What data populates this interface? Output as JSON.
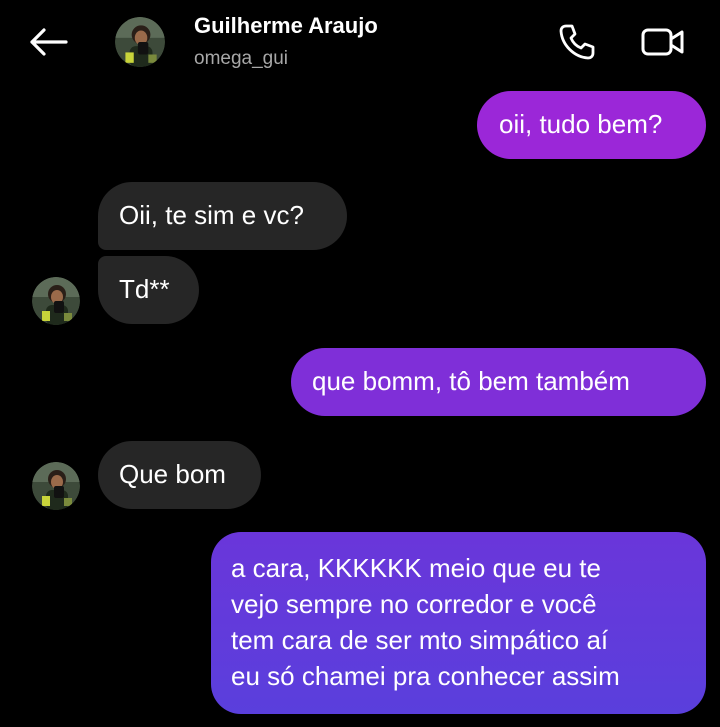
{
  "header": {
    "name": "Guilherme Araujo",
    "username": "omega_gui",
    "icons": {
      "back": "arrow-left-icon",
      "call": "phone-icon",
      "video": "video-camera-icon"
    }
  },
  "messages": [
    {
      "direction": "sent",
      "text": "oii, tudo bem?"
    },
    {
      "direction": "received",
      "text": "Oii, te sim e vc?"
    },
    {
      "direction": "received",
      "text": "Td**"
    },
    {
      "direction": "sent",
      "text": "que bomm, tô bem também"
    },
    {
      "direction": "received",
      "text": "Que bom"
    },
    {
      "direction": "sent",
      "lines": [
        "a cara, KKKKKK meio que eu te",
        "vejo sempre no corredor e você",
        "tem cara de ser mto simpático aí",
        "eu só chamei pra conhecer assim"
      ]
    }
  ],
  "colors": {
    "background": "#000000",
    "sent_bubble_top": "#9b27d8",
    "sent_bubble_bottom": "#5a3fdc",
    "received_bubble": "#262626",
    "secondary_text": "#a8a8a8"
  }
}
